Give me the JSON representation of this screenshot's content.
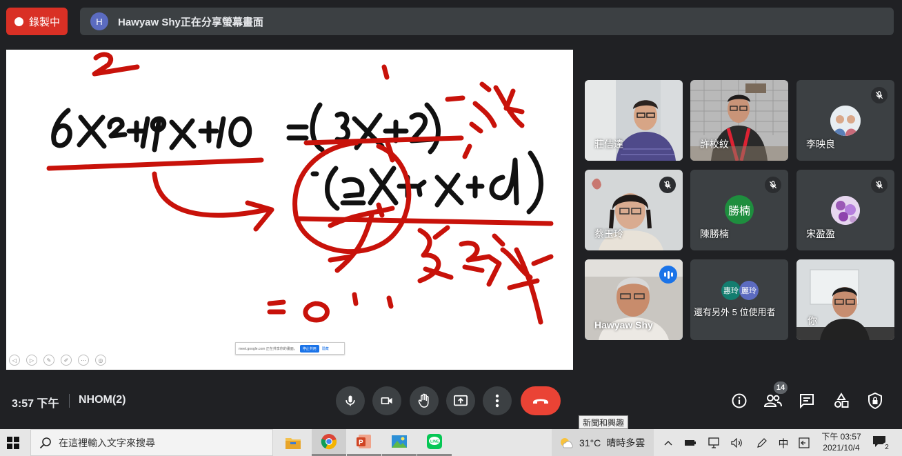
{
  "recording": {
    "label": "錄製中"
  },
  "presenter_bar": {
    "avatar_letter": "H",
    "text": "Hawyaw Shy正在分享螢幕畫面"
  },
  "share_notice": {
    "text": "meet.google.com 正在共享你的畫面。",
    "stop_label": "停止共用",
    "hide_label": "隱藏"
  },
  "participants": [
    {
      "name": "莊佶達",
      "muted": false
    },
    {
      "name": "許校紋",
      "muted": false
    },
    {
      "name": "李映良",
      "muted": true
    },
    {
      "name": "蔡玉玲",
      "muted": true
    },
    {
      "name": "陳勝楠",
      "avatar_text": "勝楠",
      "avatar_color": "#1e8e3e",
      "muted": true
    },
    {
      "name": "宋盈盈",
      "muted": true
    },
    {
      "name": "Hawyaw Shy",
      "speaking": true
    },
    {
      "name": "還有另外 5 位使用者",
      "avatars": [
        "惠玲",
        "麗玲"
      ]
    },
    {
      "name": "你"
    }
  ],
  "meeting": {
    "time": "3:57 下午",
    "code": "NHOM(2)"
  },
  "people_count": "14",
  "tooltip": "新聞和興趣",
  "taskbar": {
    "search_placeholder": "在這裡輸入文字來搜尋",
    "weather_temp": "31°C",
    "weather_desc": "晴時多雲",
    "ime": "中",
    "clock_time": "下午 03:57",
    "clock_date": "2021/10/4",
    "notification_count": "2"
  }
}
